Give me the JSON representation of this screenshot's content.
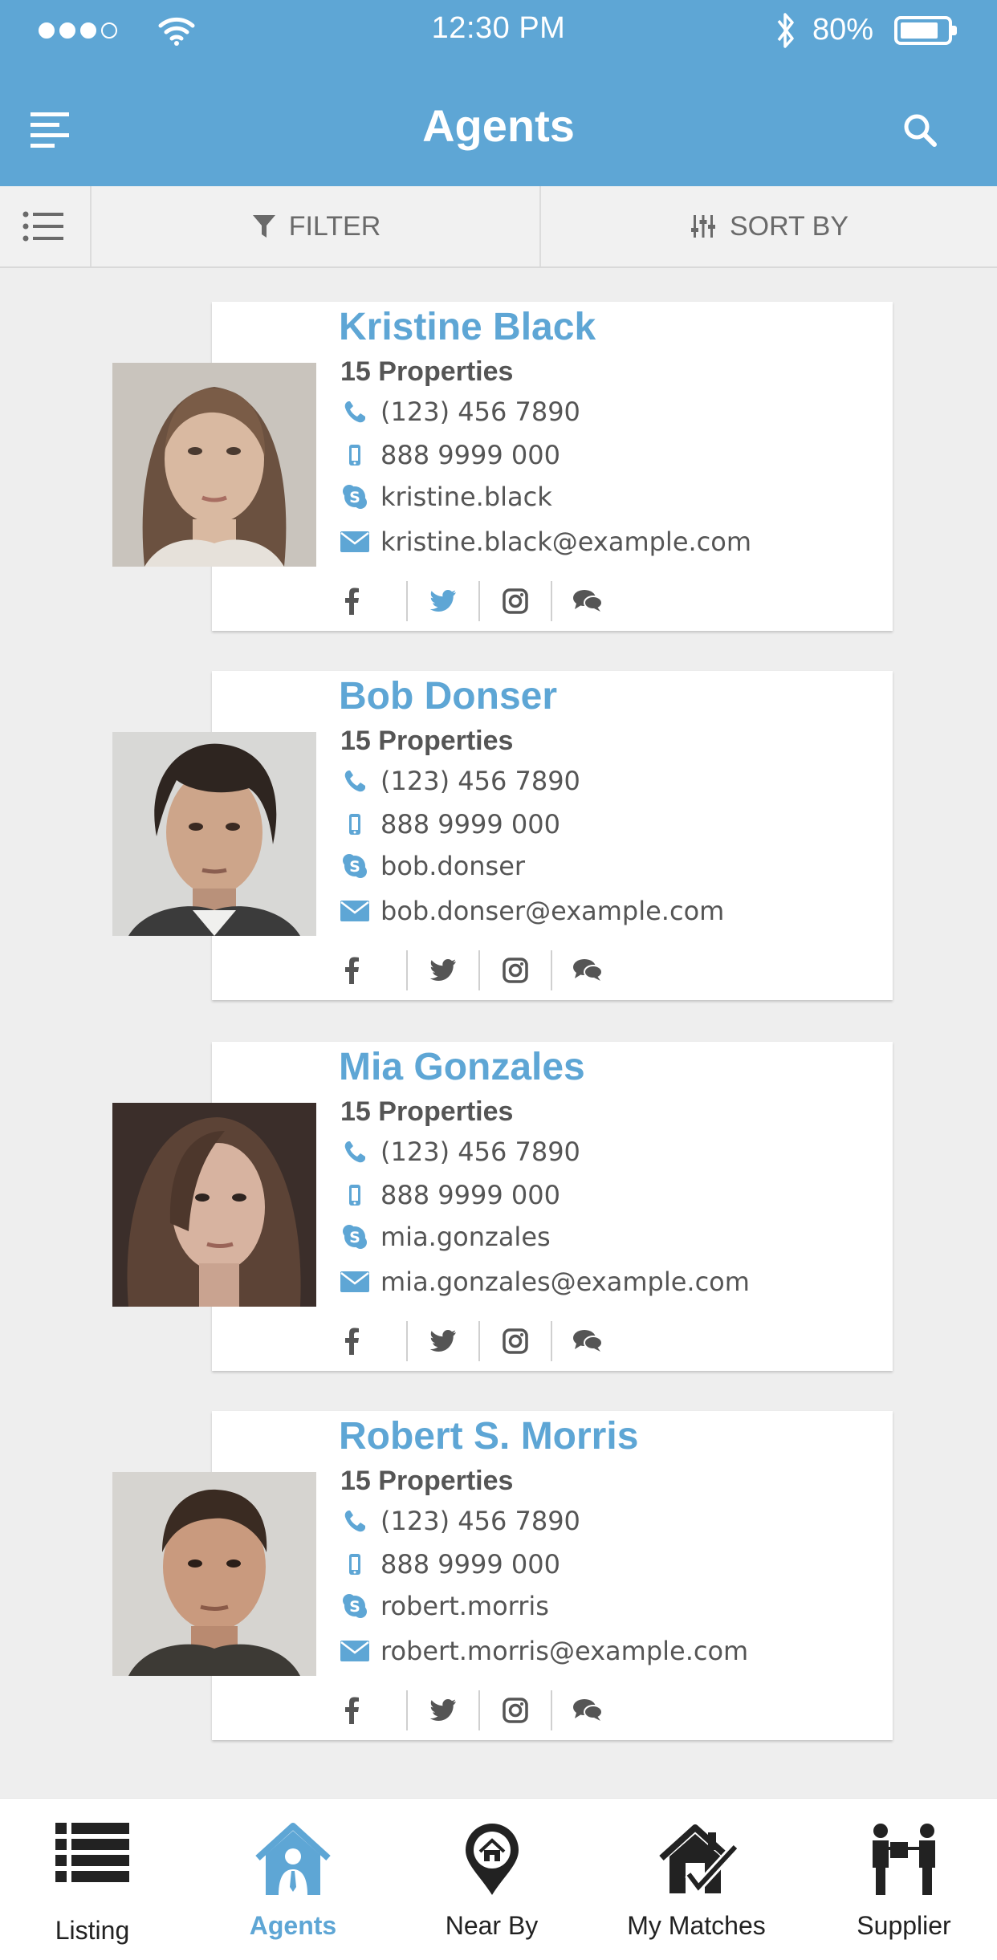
{
  "status_bar": {
    "time": "12:30 PM",
    "battery_percent": "80%",
    "battery_level": 0.8
  },
  "header": {
    "title": "Agents"
  },
  "toolbar": {
    "filter_label": "FILTER",
    "sort_label": "SORT BY"
  },
  "agents": [
    {
      "name": "Kristine Black",
      "properties": "15 Properties",
      "phone": "(123) 456 7890",
      "mobile": "888 9999 000",
      "skype": "kristine.black",
      "email": "kristine.black@example.com",
      "active_social": "twitter"
    },
    {
      "name": "Bob Donser",
      "properties": "15 Properties",
      "phone": "(123) 456 7890",
      "mobile": "888 9999 000",
      "skype": "bob.donser",
      "email": "bob.donser@example.com",
      "active_social": ""
    },
    {
      "name": "Mia Gonzales",
      "properties": "15 Properties",
      "phone": "(123) 456 7890",
      "mobile": "888 9999 000",
      "skype": "mia.gonzales",
      "email": "mia.gonzales@example.com",
      "active_social": ""
    },
    {
      "name": "Robert S. Morris",
      "properties": "15 Properties",
      "phone": "(123) 456 7890",
      "mobile": "888 9999 000",
      "skype": "robert.morris",
      "email": "robert.morris@example.com",
      "active_social": ""
    }
  ],
  "bottom_nav": {
    "active": "Agents",
    "items": [
      {
        "label": "Listing",
        "icon": "list-icon"
      },
      {
        "label": "Agents",
        "icon": "house-agent-icon"
      },
      {
        "label": "Near By",
        "icon": "map-pin-house-icon"
      },
      {
        "label": "My Matches",
        "icon": "house-check-icon"
      },
      {
        "label": "Supplier",
        "icon": "delivery-icon"
      }
    ]
  },
  "colors": {
    "primary": "#5ea6d5",
    "text": "#555555",
    "background": "#eeeeee"
  }
}
